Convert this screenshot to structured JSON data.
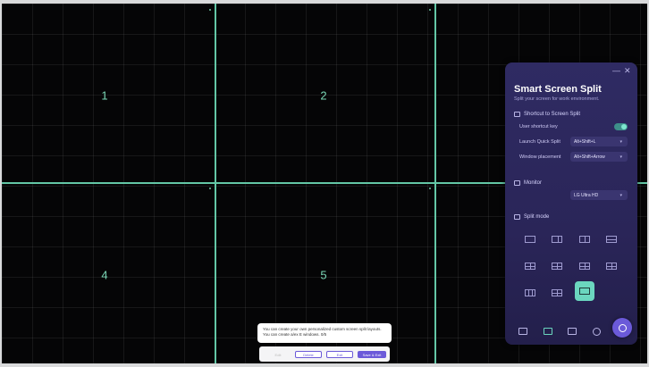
{
  "zones": [
    "1",
    "2",
    "4",
    "5"
  ],
  "panel": {
    "title": "Smart Screen Split",
    "subtitle": "Split your screen for work environment.",
    "minimize_icon": "—",
    "close_icon": "✕",
    "shortcut": {
      "header": "Shortcut to Screen Split",
      "use_key_label": "User shortcut key",
      "use_key_on": true,
      "launch_label": "Launch Quick Split",
      "launch_value": "Alt+Shift+L",
      "placement_label": "Window placement",
      "placement_value": "Alt+Shift+Arrow"
    },
    "monitor": {
      "header": "Monitor",
      "value": "LG Ultra HD"
    },
    "split_mode": {
      "header": "Split mode",
      "selected_index": 10
    },
    "accent": "#6bd6bf"
  },
  "toast": {
    "line1": "You can create your own personalized custom screen split layouts.",
    "line2": "You can create a/ex E windows. 0/5",
    "btn_disabled": "Edit",
    "btn_delete": "Delete",
    "btn_exit": "Exit",
    "btn_save": "Save & Exit"
  }
}
